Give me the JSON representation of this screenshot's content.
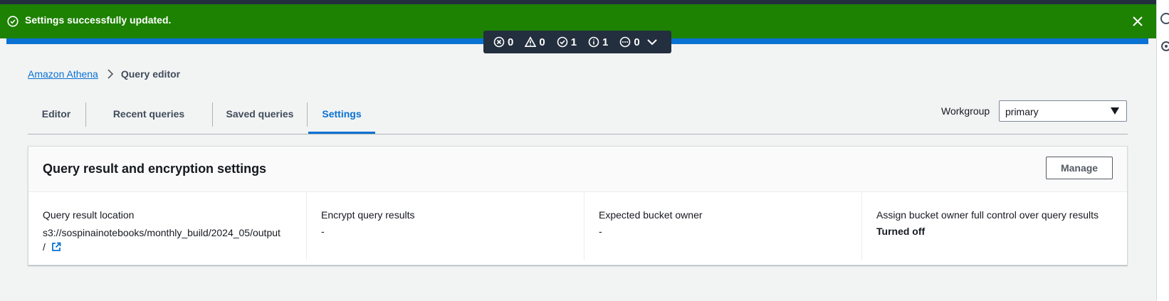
{
  "flash": {
    "message": "Settings successfully updated.",
    "color": "#1d8102"
  },
  "counter": {
    "errors": "0",
    "warnings": "0",
    "success": "1",
    "info": "1",
    "in_progress": "0"
  },
  "breadcrumb": {
    "root": "Amazon Athena",
    "current": "Query editor"
  },
  "tabs": [
    {
      "label": "Editor"
    },
    {
      "label": "Recent queries"
    },
    {
      "label": "Saved queries"
    },
    {
      "label": "Settings"
    }
  ],
  "active_tab": "Settings",
  "workgroup": {
    "label": "Workgroup",
    "value": "primary"
  },
  "panel": {
    "title": "Query result and encryption settings",
    "manage_label": "Manage",
    "columns": [
      {
        "label": "Query result location",
        "value_line1": "s3://sospinainotebooks/monthly_build/2024_05/output",
        "value_line2": "/"
      },
      {
        "label": "Encrypt query results",
        "value": "-"
      },
      {
        "label": "Expected bucket owner",
        "value": "-"
      },
      {
        "label": "Assign bucket owner full control over query results",
        "value": "Turned off"
      }
    ]
  },
  "colors": {
    "accent": "#0972d3",
    "flash_success": "#1d8102",
    "topbar": "#232f3e"
  },
  "icons": [
    "success-circle-icon",
    "close-icon",
    "error-icon",
    "warning-icon",
    "success-icon",
    "info-icon",
    "in-progress-icon",
    "chevron-down-icon",
    "chevron-right-icon",
    "caret-down-icon",
    "external-link-icon"
  ]
}
